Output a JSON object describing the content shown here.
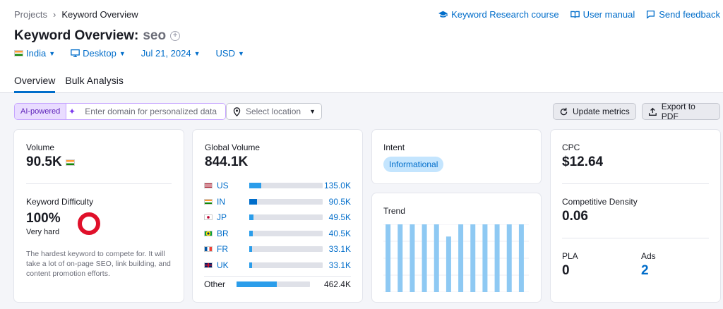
{
  "breadcrumb": {
    "projects": "Projects",
    "current": "Keyword Overview"
  },
  "header_links": {
    "course": "Keyword Research course",
    "manual": "User manual",
    "feedback": "Send feedback"
  },
  "title": {
    "label": "Keyword Overview:",
    "keyword": "seo"
  },
  "filters": {
    "country": "India",
    "device": "Desktop",
    "date": "Jul 21, 2024",
    "currency": "USD"
  },
  "tabs": [
    "Overview",
    "Bulk Analysis"
  ],
  "toolbar": {
    "ai_badge": "AI-powered",
    "domain_placeholder": "Enter domain for personalized data",
    "location_placeholder": "Select location",
    "update": "Update metrics",
    "export": "Export to PDF"
  },
  "volume": {
    "label": "Volume",
    "value": "90.5K"
  },
  "difficulty": {
    "label": "Keyword Difficulty",
    "value": "100%",
    "rating": "Very hard",
    "description": "The hardest keyword to compete for. It will take a lot of on-page SEO, link building, and content promotion efforts."
  },
  "global_volume": {
    "label": "Global Volume",
    "value": "844.1K",
    "countries": [
      {
        "code": "US",
        "value": "135.0K",
        "share": 0.16,
        "dark": false
      },
      {
        "code": "IN",
        "value": "90.5K",
        "share": 0.107,
        "dark": true
      },
      {
        "code": "JP",
        "value": "49.5K",
        "share": 0.059,
        "dark": false
      },
      {
        "code": "BR",
        "value": "40.5K",
        "share": 0.048,
        "dark": false
      },
      {
        "code": "FR",
        "value": "33.1K",
        "share": 0.039,
        "dark": false
      },
      {
        "code": "UK",
        "value": "33.1K",
        "share": 0.039,
        "dark": false
      }
    ],
    "other": {
      "label": "Other",
      "value": "462.4K",
      "share": 0.548
    }
  },
  "intent": {
    "label": "Intent",
    "value": "Informational"
  },
  "trend": {
    "label": "Trend",
    "bars": [
      1,
      1,
      1,
      1,
      1,
      0.82,
      1,
      1,
      1,
      1,
      1,
      1
    ]
  },
  "cpc": {
    "label": "CPC",
    "value": "$12.64"
  },
  "density": {
    "label": "Competitive Density",
    "value": "0.06"
  },
  "pla": {
    "label": "PLA",
    "value": "0"
  },
  "ads": {
    "label": "Ads",
    "value": "2"
  },
  "colors": {
    "accent": "#006dca",
    "bar": "#2b9dea",
    "bar_dark": "#006dca",
    "trend": "#8ec9f3",
    "difficulty": "#e0102a"
  }
}
